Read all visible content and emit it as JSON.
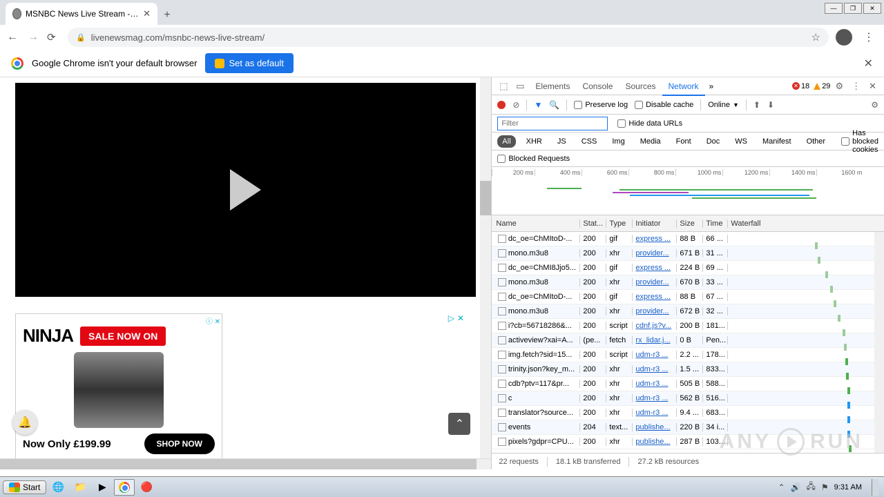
{
  "browser": {
    "tab_title": "MSNBC News Live Stream - MSNBC L",
    "url": "livenewsmag.com/msnbc-news-live-stream/"
  },
  "info_bar": {
    "text": "Google Chrome isn't your default browser",
    "button": "Set as default"
  },
  "ad": {
    "brand": "NINJA",
    "sale": "SALE NOW ON",
    "price": "Now Only £199.99",
    "shop": "SHOP NOW"
  },
  "devtools": {
    "tabs": [
      "Elements",
      "Console",
      "Sources",
      "Network"
    ],
    "active_tab": 3,
    "errors": "18",
    "warnings": "29",
    "preserve_log": "Preserve log",
    "disable_cache": "Disable cache",
    "throttle": "Online",
    "filter_placeholder": "Filter",
    "hide_urls": "Hide data URLs",
    "types": [
      "All",
      "XHR",
      "JS",
      "CSS",
      "Img",
      "Media",
      "Font",
      "Doc",
      "WS",
      "Manifest",
      "Other"
    ],
    "blocked_cookies": "Has blocked cookies",
    "blocked_requests": "Blocked Requests",
    "timeline_ticks": [
      "200 ms",
      "400 ms",
      "600 ms",
      "800 ms",
      "1000 ms",
      "1200 ms",
      "1400 ms",
      "1600 m"
    ],
    "columns": [
      "Name",
      "Stat...",
      "Type",
      "Initiator",
      "Size",
      "Time",
      "Waterfall"
    ],
    "rows": [
      {
        "name": "dc_oe=ChMItoD-...",
        "status": "200",
        "type": "gif",
        "init": "express ...",
        "size": "88 B",
        "time": "66 ...",
        "wf": 70
      },
      {
        "name": "mono.m3u8",
        "status": "200",
        "type": "xhr",
        "init": "provider...",
        "size": "671 B",
        "time": "31 ...",
        "wf": 72
      },
      {
        "name": "dc_oe=ChMI8Jjo5...",
        "status": "200",
        "type": "gif",
        "init": "express ...",
        "size": "224 B",
        "time": "69 ...",
        "wf": 78
      },
      {
        "name": "mono.m3u8",
        "status": "200",
        "type": "xhr",
        "init": "provider...",
        "size": "670 B",
        "time": "33 ...",
        "wf": 82
      },
      {
        "name": "dc_oe=ChMItoD-...",
        "status": "200",
        "type": "gif",
        "init": "express ...",
        "size": "88 B",
        "time": "67 ...",
        "wf": 85
      },
      {
        "name": "mono.m3u8",
        "status": "200",
        "type": "xhr",
        "init": "provider...",
        "size": "672 B",
        "time": "32 ...",
        "wf": 88
      },
      {
        "name": "i?cb=56718286&...",
        "status": "200",
        "type": "script",
        "init": "cdnf.js?v...",
        "size": "200 B",
        "time": "181...",
        "wf": 92
      },
      {
        "name": "activeview?xai=A...",
        "status": "(pe...",
        "type": "fetch",
        "init": "rx_lidar.j...",
        "size": "0 B",
        "time": "Pen...",
        "wf": 93
      },
      {
        "name": "img.fetch?sid=15...",
        "status": "200",
        "type": "script",
        "init": "udm-r3 ...",
        "size": "2.2 ...",
        "time": "178...",
        "wf": 94,
        "green": true
      },
      {
        "name": "trinity.json?key_m...",
        "status": "200",
        "type": "xhr",
        "init": "udm-r3 ...",
        "size": "1.5 ...",
        "time": "833...",
        "wf": 95,
        "green": true
      },
      {
        "name": "cdb?ptv=117&pr...",
        "status": "200",
        "type": "xhr",
        "init": "udm-r3 ...",
        "size": "505 B",
        "time": "588...",
        "wf": 96,
        "green": true
      },
      {
        "name": "c",
        "status": "200",
        "type": "xhr",
        "init": "udm-r3 ...",
        "size": "562 B",
        "time": "516...",
        "wf": 96,
        "blue": true
      },
      {
        "name": "translator?source...",
        "status": "200",
        "type": "xhr",
        "init": "udm-r3 ...",
        "size": "9.4 ...",
        "time": "683...",
        "wf": 96,
        "blue": true
      },
      {
        "name": "events",
        "status": "204",
        "type": "text...",
        "init": "publishe...",
        "size": "220 B",
        "time": "34 i...",
        "wf": 96,
        "blue": true
      },
      {
        "name": "pixels?gdpr=CPU...",
        "status": "200",
        "type": "xhr",
        "init": "publishe...",
        "size": "287 B",
        "time": "103...",
        "wf": 97,
        "green": true
      }
    ],
    "footer": {
      "requests": "22 requests",
      "transferred": "18.1 kB transferred",
      "resources": "27.2 kB resources"
    }
  },
  "taskbar": {
    "start": "Start",
    "time": "9:31 AM"
  },
  "watermark": {
    "a": "ANY",
    "b": "RUN"
  }
}
